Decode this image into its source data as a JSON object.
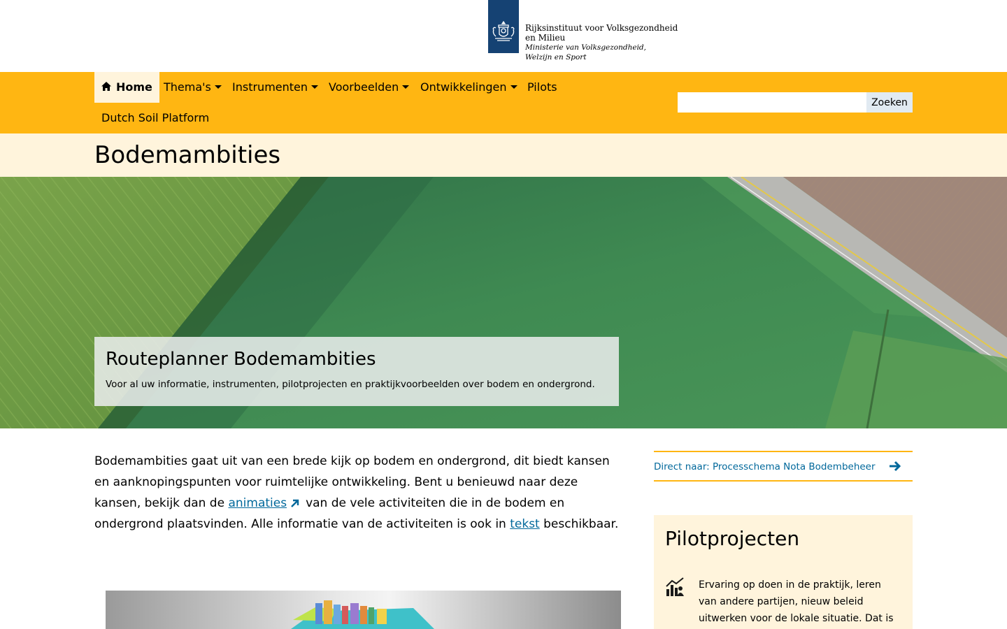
{
  "header": {
    "logo_line1": "Rijksinstituut voor Volksgezondheid",
    "logo_line2": "en Milieu",
    "logo_line3": "Ministerie van Volksgezondheid,",
    "logo_line4": "Welzijn en Sport"
  },
  "nav": {
    "items": [
      {
        "label": "Home"
      },
      {
        "label": "Thema's"
      },
      {
        "label": "Instrumenten"
      },
      {
        "label": "Voorbeelden"
      },
      {
        "label": "Ontwikkelingen"
      },
      {
        "label": "Pilots"
      },
      {
        "label": "Dutch Soil Platform"
      }
    ],
    "search_button": "Zoeken",
    "search_value": ""
  },
  "page": {
    "title": "Bodemambities"
  },
  "hero": {
    "title": "Routeplanner Bodemambities",
    "subtitle": "Voor al uw informatie, instrumenten, pilotprojecten en praktijkvoorbeelden over bodem en ondergrond."
  },
  "intro": {
    "part1": "Bodemambities gaat uit van een brede kijk op bodem en ondergrond, dit biedt kansen en aanknopingspunten voor ruimtelijke ontwikkeling. Bent u benieuwd naar deze kansen, bekijk dan de ",
    "link1": "animaties",
    "part2": "van de vele activiteiten die in de bodem en ondergrond plaatsvinden. Alle informatie van de activiteiten is ook in ",
    "link2": "tekst",
    "part3": " beschikbaar."
  },
  "sidebar": {
    "direct_link": "Direct naar: Processchema Nota Bodembeheer",
    "pilot_title": "Pilotprojecten",
    "pilot_text": "Ervaring op doen in de praktijk, leren van andere partijen, nieuw beleid uitwerken voor de lokale situatie. Dat is waar"
  },
  "colors": {
    "nav_bg": "#ffb612",
    "light_bg": "#fff4dc",
    "logo_blue": "#154273",
    "link_blue": "#01689b"
  },
  "icons": [
    "rijksoverheid-emblem-icon",
    "home-icon",
    "caret-down-icon",
    "external-link-icon",
    "arrow-right-icon",
    "chart-people-icon"
  ]
}
